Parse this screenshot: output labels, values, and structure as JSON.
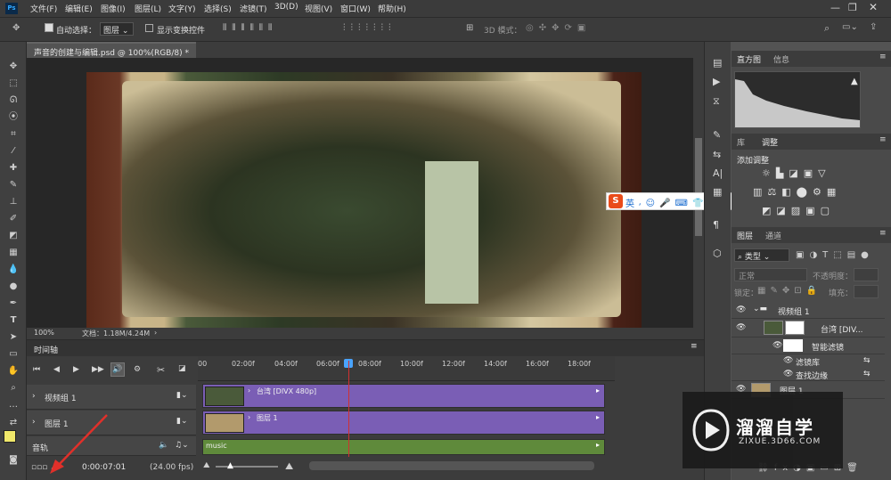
{
  "menus": [
    "文件(F)",
    "编辑(E)",
    "图像(I)",
    "图层(L)",
    "文字(Y)",
    "选择(S)",
    "滤镜(T)",
    "3D(D)",
    "视图(V)",
    "窗口(W)",
    "帮助(H)"
  ],
  "options": {
    "auto_select": "自动选择：",
    "layer_dropdown": "图层",
    "show_transform": "显示变换控件",
    "mode_3d": "3D 模式："
  },
  "document": {
    "tab_title": "声音的创建与编辑.psd @ 100%(RGB/8) *",
    "zoom": "100%",
    "doc_size": "文档：1.18M/4.24M"
  },
  "timeline": {
    "title": "时间轴",
    "ruler": [
      "00",
      "02:00f",
      "04:00f",
      "06:00f",
      "08:00f",
      "10:00f",
      "12:00f",
      "14:00f",
      "16:00f",
      "18:00f"
    ],
    "tracks": [
      {
        "name": "视频组 1"
      },
      {
        "name": "图层 1"
      },
      {
        "name": "音轨"
      }
    ],
    "clips": {
      "video1": "台湾 [DIVX 480p]",
      "layer1": "图层 1",
      "audio": "music"
    },
    "timecode": "0:00:07:01",
    "fps": "(24.00 fps)"
  },
  "panels": {
    "tab_histogram": "直方图",
    "tab_info": "信息",
    "tab_library": "库",
    "tab_adjust": "调整",
    "add_adjust": "添加调整",
    "tab_layers": "图层",
    "tab_channels": "通道",
    "layer_filter": "类型",
    "blend": "正常",
    "opacity_label": "不透明度：",
    "lock_label": "锁定：",
    "fill_label": "填充：",
    "layers": [
      {
        "name": "视频组 1"
      },
      {
        "name": "台湾 [DIV..."
      },
      {
        "name": "智能滤镜"
      },
      {
        "name": "滤镜库"
      },
      {
        "name": "查找边缘"
      },
      {
        "name": "图层 1"
      }
    ]
  },
  "watermark": {
    "title": "溜溜自学",
    "url": "ZIXUE.3D66.COM"
  },
  "ime": {
    "label": "英"
  }
}
